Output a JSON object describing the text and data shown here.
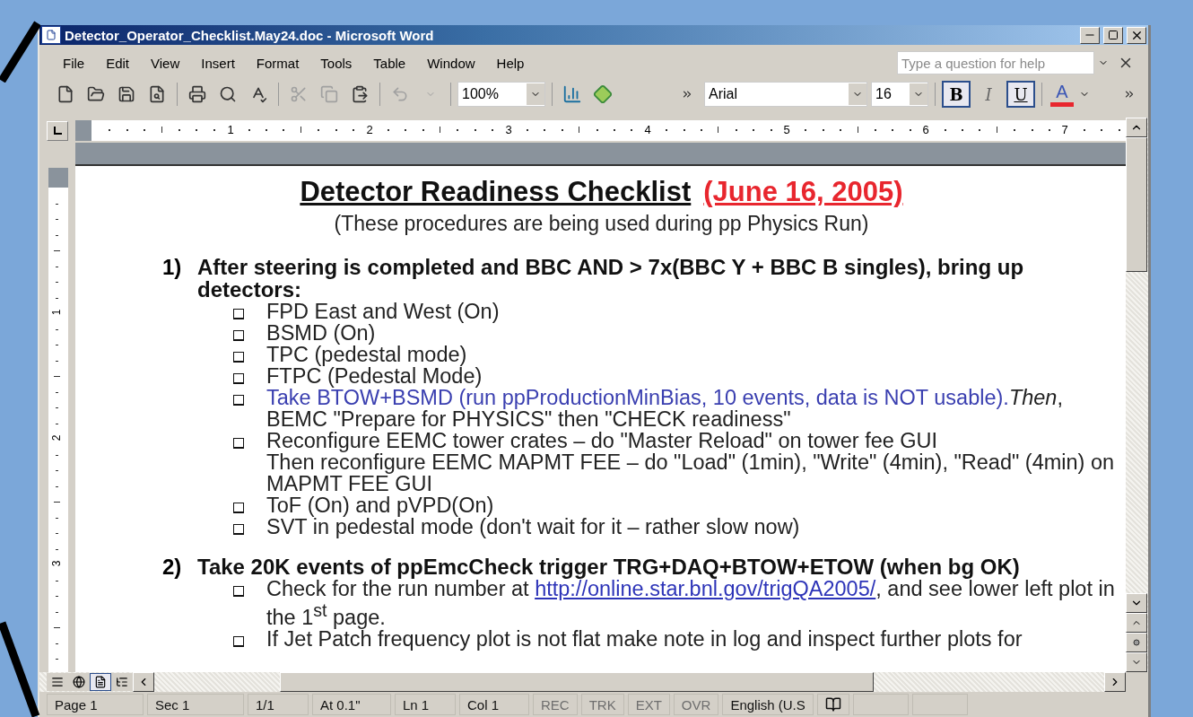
{
  "window": {
    "title": "Detector_Operator_Checklist.May24.doc - Microsoft Word"
  },
  "menu": [
    "File",
    "Edit",
    "View",
    "Insert",
    "Format",
    "Tools",
    "Table",
    "Window",
    "Help"
  ],
  "help_box": {
    "placeholder": "Type a question for help"
  },
  "standard_toolbar": [
    {
      "kind": "new",
      "disabled": false
    },
    {
      "kind": "open",
      "disabled": false
    },
    {
      "kind": "save",
      "disabled": false
    },
    {
      "kind": "permission",
      "disabled": false
    },
    {
      "kind": "sep"
    },
    {
      "kind": "print",
      "disabled": false
    },
    {
      "kind": "preview",
      "disabled": false
    },
    {
      "kind": "spelling",
      "disabled": false
    },
    {
      "kind": "sep"
    },
    {
      "kind": "cut",
      "disabled": true
    },
    {
      "kind": "copy",
      "disabled": true
    },
    {
      "kind": "paste",
      "disabled": false
    },
    {
      "kind": "sep"
    },
    {
      "kind": "undo",
      "disabled": true
    }
  ],
  "zoom": {
    "value": "100%"
  },
  "font": {
    "value": "Arial"
  },
  "font_size": {
    "value": "16"
  },
  "format_buttons": [
    {
      "label": "B",
      "kind": "bold",
      "selected": true
    },
    {
      "label": "I",
      "kind": "italic",
      "selected": false
    },
    {
      "label": "U",
      "kind": "underline",
      "selected": true
    }
  ],
  "font_color": {
    "label": "A",
    "color": "#e8262e"
  },
  "ruler": {
    "marks": [
      "1",
      "2",
      "3",
      "4",
      "5",
      "6",
      "7"
    ]
  },
  "vertical_ruler": {
    "marks": [
      "1",
      "2",
      "3"
    ]
  },
  "document": {
    "title": "Detector Readiness Checklist",
    "date": "(June 16, 2005)",
    "subtitle": "(These procedures are being used during pp Physics Run)",
    "sections": [
      {
        "number": "1)",
        "heading": "After steering is completed and BBC AND > 7x(BBC Y + BBC B singles), bring up detectors:",
        "items": [
          {
            "lines": [
              [
                {
                  "text": "FPD East and West (On)",
                  "kind": "plain"
                }
              ]
            ]
          },
          {
            "lines": [
              [
                {
                  "text": "BSMD (On)",
                  "kind": "plain"
                }
              ]
            ]
          },
          {
            "lines": [
              [
                {
                  "text": "TPC (pedestal mode)",
                  "kind": "plain"
                }
              ]
            ]
          },
          {
            "lines": [
              [
                {
                  "text": "FTPC (Pedestal Mode)",
                  "kind": "plain"
                }
              ]
            ]
          },
          {
            "lines": [
              [
                {
                  "text": "Take BTOW+BSMD (run ppProductionMinBias, 10 events, data is NOT usable).",
                  "kind": "blue"
                },
                {
                  "text": "*Then*,",
                  "kind": "plain"
                }
              ],
              [
                {
                  "text": "BEMC \"Prepare for PHYSICS\"  then \"CHECK readiness\"",
                  "kind": "plain"
                }
              ]
            ]
          },
          {
            "lines": [
              [
                {
                  "text": "Reconfigure EEMC tower crates – do \"Master Reload\" on tower fee GUI",
                  "kind": "plain"
                }
              ],
              [
                {
                  "text": "Then reconfigure EEMC MAPMT FEE – do \"Load\" (1min), \"Write\" (4min), \"Read\" (4min) on",
                  "kind": "plain"
                }
              ],
              [
                {
                  "text": "MAPMT FEE GUI",
                  "kind": "plain"
                }
              ]
            ]
          },
          {
            "lines": [
              [
                {
                  "text": "ToF (On) and pVPD(On)",
                  "kind": "plain"
                }
              ]
            ]
          },
          {
            "lines": [
              [
                {
                  "text": "SVT in pedestal mode (don't wait for it – rather slow now)",
                  "kind": "plain"
                }
              ]
            ]
          }
        ]
      },
      {
        "number": "2)",
        "heading": "Take  20K events of ppEmcCheck trigger TRG+DAQ+BTOW+ETOW (when bg OK)",
        "items": [
          {
            "lines": [
              [
                {
                  "text": "Check for the run number at ",
                  "kind": "plain"
                },
                {
                  "text": "http://online.star.bnl.gov/trigQA2005/",
                  "kind": "link"
                },
                {
                  "text": ", and see lower left plot in",
                  "kind": "plain"
                }
              ],
              [
                {
                  "text": "the 1$^{st}$ page.",
                  "kind": "plain"
                }
              ]
            ]
          },
          {
            "lines": [
              [
                {
                  "text": "If  Jet Patch frequency plot is not flat make note in log and inspect further plots for",
                  "kind": "plain"
                }
              ]
            ]
          }
        ]
      }
    ]
  },
  "view_buttons": [
    {
      "kind": "normal",
      "selected": false
    },
    {
      "kind": "web",
      "selected": false
    },
    {
      "kind": "print",
      "selected": true
    },
    {
      "kind": "outline",
      "selected": false
    }
  ],
  "status_bar": [
    {
      "text": "Page  1",
      "kind": "info"
    },
    {
      "text": "Sec  1",
      "kind": "info"
    },
    {
      "text": "1/1",
      "kind": "info"
    },
    {
      "text": "At  0.1\"",
      "kind": "info"
    },
    {
      "text": "Ln  1",
      "kind": "info"
    },
    {
      "text": "Col  1",
      "kind": "info"
    },
    {
      "text": "REC",
      "kind": "mode",
      "disabled": true
    },
    {
      "text": "TRK",
      "kind": "mode",
      "disabled": true
    },
    {
      "text": "EXT",
      "kind": "mode",
      "disabled": true
    },
    {
      "text": "OVR",
      "kind": "mode",
      "disabled": true
    },
    {
      "text": "English (U.S",
      "kind": "language"
    },
    {
      "kind": "book"
    }
  ]
}
